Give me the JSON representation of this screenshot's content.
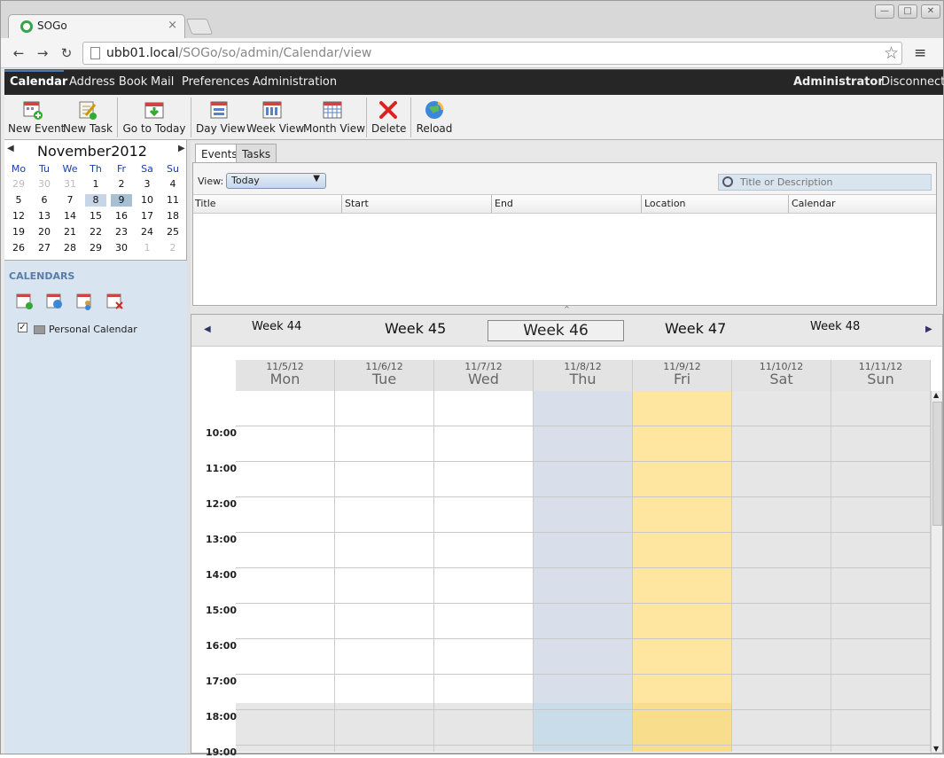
{
  "browser": {
    "tab_title": "SOGo",
    "tab_close": "×",
    "url_host": "ubb01.local",
    "url_path": "/SOGo/so/admin/Calendar/view",
    "back": "←",
    "forward": "→",
    "reload": "↻",
    "star": "☆",
    "menu": "≡",
    "min": "—",
    "max": "□",
    "close": "✕"
  },
  "appbar": {
    "nav": [
      "Calendar",
      "Address Book",
      "Mail",
      "Preferences",
      "Administration"
    ],
    "user": "Administrator",
    "disconnect": "Disconnect"
  },
  "toolbar": {
    "new_event": "New Event",
    "new_task": "New Task",
    "go_to_today": "Go to Today",
    "day_view": "Day View",
    "week_view": "Week View",
    "month_view": "Month View",
    "delete": "Delete",
    "reload": "Reload"
  },
  "minical": {
    "month": "November",
    "year": "2012",
    "prev": "◀",
    "next": "▶",
    "day_headers": [
      "Mo",
      "Tu",
      "We",
      "Th",
      "Fr",
      "Sa",
      "Su"
    ],
    "weeks": [
      [
        "29",
        "30",
        "31",
        "1",
        "2",
        "3",
        "4"
      ],
      [
        "5",
        "6",
        "7",
        "8",
        "9",
        "10",
        "11"
      ],
      [
        "12",
        "13",
        "14",
        "15",
        "16",
        "17",
        "18"
      ],
      [
        "19",
        "20",
        "21",
        "22",
        "23",
        "24",
        "25"
      ],
      [
        "26",
        "27",
        "28",
        "29",
        "30",
        "1",
        "2"
      ]
    ]
  },
  "calendars": {
    "heading": "CALENDARS",
    "items": [
      {
        "label": "Personal Calendar",
        "checked": true
      }
    ]
  },
  "list": {
    "tabs": [
      "Events",
      "Tasks"
    ],
    "view_label": "View:",
    "view_value": "Today",
    "search_placeholder": "Title or Description",
    "columns": [
      "Title",
      "Start",
      "End",
      "Location",
      "Calendar"
    ]
  },
  "week": {
    "weeks": [
      "Week 44",
      "Week 45",
      "Week 46",
      "Week 47",
      "Week 48"
    ],
    "days": [
      {
        "date": "11/5/12",
        "name": "Mon"
      },
      {
        "date": "11/6/12",
        "name": "Tue"
      },
      {
        "date": "11/7/12",
        "name": "Wed"
      },
      {
        "date": "11/8/12",
        "name": "Thu"
      },
      {
        "date": "11/9/12",
        "name": "Fri"
      },
      {
        "date": "11/10/12",
        "name": "Sat"
      },
      {
        "date": "11/11/12",
        "name": "Sun"
      }
    ],
    "hours": [
      "10:00",
      "11:00",
      "12:00",
      "13:00",
      "14:00",
      "15:00",
      "16:00",
      "17:00",
      "18:00",
      "19:00"
    ]
  },
  "colors": {
    "selected_day": "#d8dfea",
    "today": "#fee6a0",
    "weekend": "#e6e6e6",
    "offhours": "#e6e6e6"
  }
}
